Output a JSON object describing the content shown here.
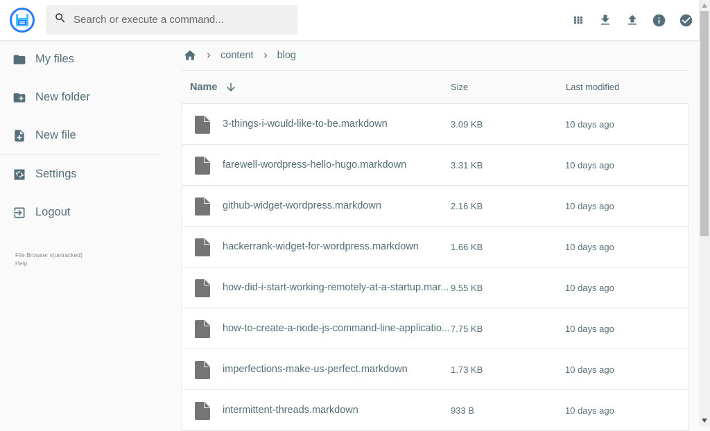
{
  "search": {
    "placeholder": "Search or execute a command..."
  },
  "header": {
    "actions": [
      "grid-view-icon",
      "download-icon",
      "upload-icon",
      "info-icon",
      "select-check-icon"
    ]
  },
  "sidebar": {
    "items": [
      {
        "label": "My files",
        "icon": "folder-icon"
      },
      {
        "label": "New folder",
        "icon": "new-folder-icon"
      },
      {
        "label": "New file",
        "icon": "new-file-icon"
      },
      {
        "label": "Settings",
        "icon": "settings-icon"
      },
      {
        "label": "Logout",
        "icon": "logout-icon"
      }
    ],
    "credits": {
      "version": "File Browser v(untracked)",
      "help": "Help"
    }
  },
  "breadcrumb": {
    "items": [
      "content",
      "blog"
    ]
  },
  "columns": {
    "name": "Name",
    "size": "Size",
    "modified": "Last modified"
  },
  "files": [
    {
      "name": "3-things-i-would-like-to-be.markdown",
      "size": "3.09 KB",
      "modified": "10 days ago"
    },
    {
      "name": "farewell-wordpress-hello-hugo.markdown",
      "size": "3.31 KB",
      "modified": "10 days ago"
    },
    {
      "name": "github-widget-wordpress.markdown",
      "size": "2.16 KB",
      "modified": "10 days ago"
    },
    {
      "name": "hackerrank-widget-for-wordpress.markdown",
      "size": "1.66 KB",
      "modified": "10 days ago"
    },
    {
      "name": "how-did-i-start-working-remotely-at-a-startup.mar...",
      "size": "9.55 KB",
      "modified": "10 days ago"
    },
    {
      "name": "how-to-create-a-node-js-command-line-applicatio...",
      "size": "7.75 KB",
      "modified": "10 days ago"
    },
    {
      "name": "imperfections-make-us-perfect.markdown",
      "size": "1.73 KB",
      "modified": "10 days ago"
    },
    {
      "name": "intermittent-threads.markdown",
      "size": "933 B",
      "modified": "10 days ago"
    }
  ],
  "colors": {
    "accent": "#2979ff",
    "text": "#546e7a",
    "icon": "#546e7a",
    "file_icon": "#757575"
  }
}
